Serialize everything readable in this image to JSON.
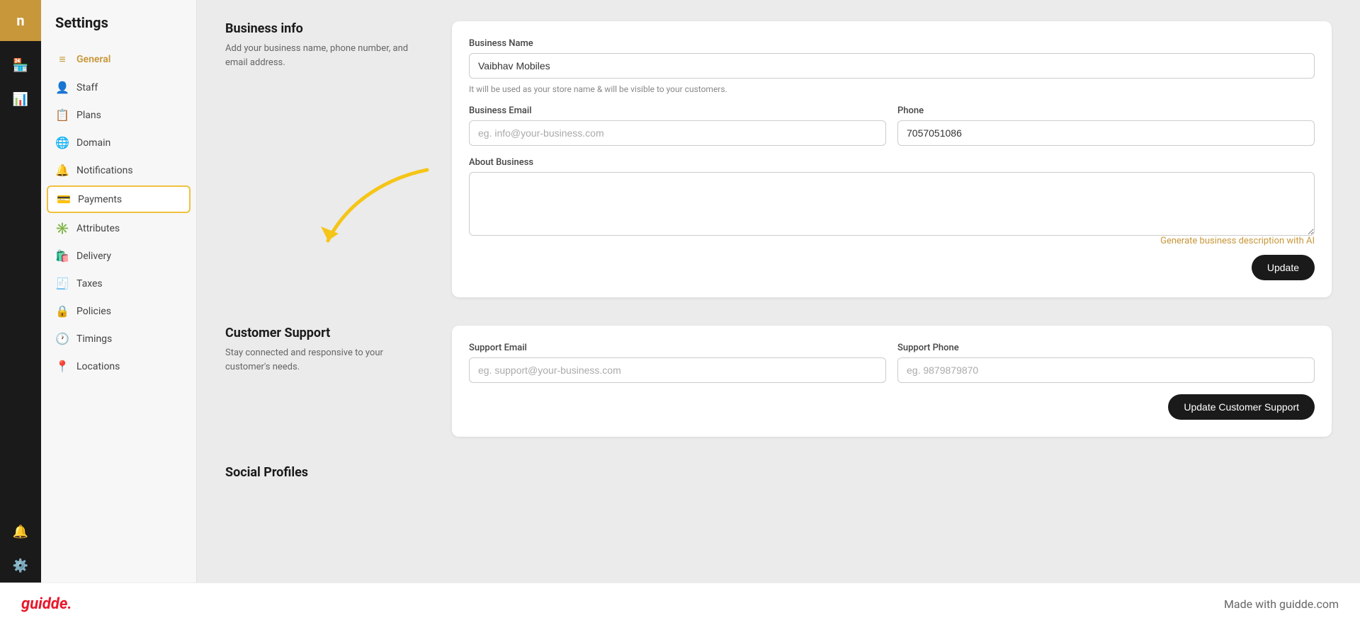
{
  "app": {
    "logo": "n",
    "title": "Settings"
  },
  "icon_sidebar": {
    "items": [
      {
        "name": "store-icon",
        "symbol": "🏪"
      },
      {
        "name": "analytics-icon",
        "symbol": "📊"
      },
      {
        "name": "bell-icon",
        "symbol": "🔔"
      },
      {
        "name": "settings-icon",
        "symbol": "⚙️"
      }
    ]
  },
  "nav": {
    "title": "Settings",
    "items": [
      {
        "id": "general",
        "label": "General",
        "icon": "≡",
        "active": true
      },
      {
        "id": "staff",
        "label": "Staff",
        "icon": "👤"
      },
      {
        "id": "plans",
        "label": "Plans",
        "icon": "📋"
      },
      {
        "id": "domain",
        "label": "Domain",
        "icon": "🌐"
      },
      {
        "id": "notifications",
        "label": "Notifications",
        "icon": "🔔"
      },
      {
        "id": "payments",
        "label": "Payments",
        "icon": "💳",
        "highlighted": true
      },
      {
        "id": "attributes",
        "label": "Attributes",
        "icon": "✳️"
      },
      {
        "id": "delivery",
        "label": "Delivery",
        "icon": "🛍️"
      },
      {
        "id": "taxes",
        "label": "Taxes",
        "icon": "🧾"
      },
      {
        "id": "policies",
        "label": "Policies",
        "icon": "🔒"
      },
      {
        "id": "timings",
        "label": "Timings",
        "icon": "🕐"
      },
      {
        "id": "locations",
        "label": "Locations",
        "icon": "📍"
      }
    ]
  },
  "business_info": {
    "section_title": "Business info",
    "section_desc": "Add your business name, phone number, and email address.",
    "business_name_label": "Business Name",
    "business_name_value": "Vaibhav Mobiles",
    "business_name_hint": "It will be used as your store name & will be visible to your customers.",
    "business_email_label": "Business Email",
    "business_email_placeholder": "eg. info@your-business.com",
    "phone_label": "Phone",
    "phone_value": "7057051086",
    "about_label": "About Business",
    "about_value": "",
    "ai_link": "Generate business description with AI",
    "update_button": "Update"
  },
  "customer_support": {
    "section_title": "Customer Support",
    "section_desc": "Stay connected and responsive to your customer's needs.",
    "support_email_label": "Support Email",
    "support_email_placeholder": "eg. support@your-business.com",
    "support_phone_label": "Support Phone",
    "support_phone_placeholder": "eg. 9879879870",
    "update_button": "Update Customer Support"
  },
  "social_profiles": {
    "section_title": "Social Profiles"
  },
  "footer": {
    "logo": "guidde.",
    "tagline": "Made with guidde.com"
  }
}
